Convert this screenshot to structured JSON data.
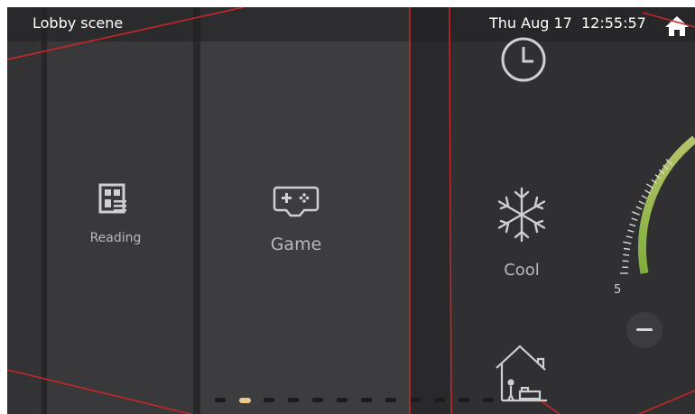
{
  "header": {
    "title": "Lobby scene",
    "datetime": "Thu Aug 17  12:55:57",
    "home_icon": "home-icon"
  },
  "tiles": {
    "reading": {
      "label": "Reading",
      "icon": "reading-icon"
    },
    "game": {
      "label": "Game",
      "icon": "gamepad-icon"
    },
    "clock": {
      "icon": "clock-icon"
    },
    "cool": {
      "label": "Cool",
      "icon": "snowflake-icon"
    },
    "house": {
      "icon": "house-bedroom-icon"
    }
  },
  "thermostat": {
    "scale_min": "5",
    "minus_icon": "minus-icon"
  },
  "pager": {
    "page_count": 12,
    "active_index": 1
  },
  "colors": {
    "accent_gold": "#e7c98c",
    "gauge_green": "#8db84a",
    "divider_red": "#c8262a"
  }
}
